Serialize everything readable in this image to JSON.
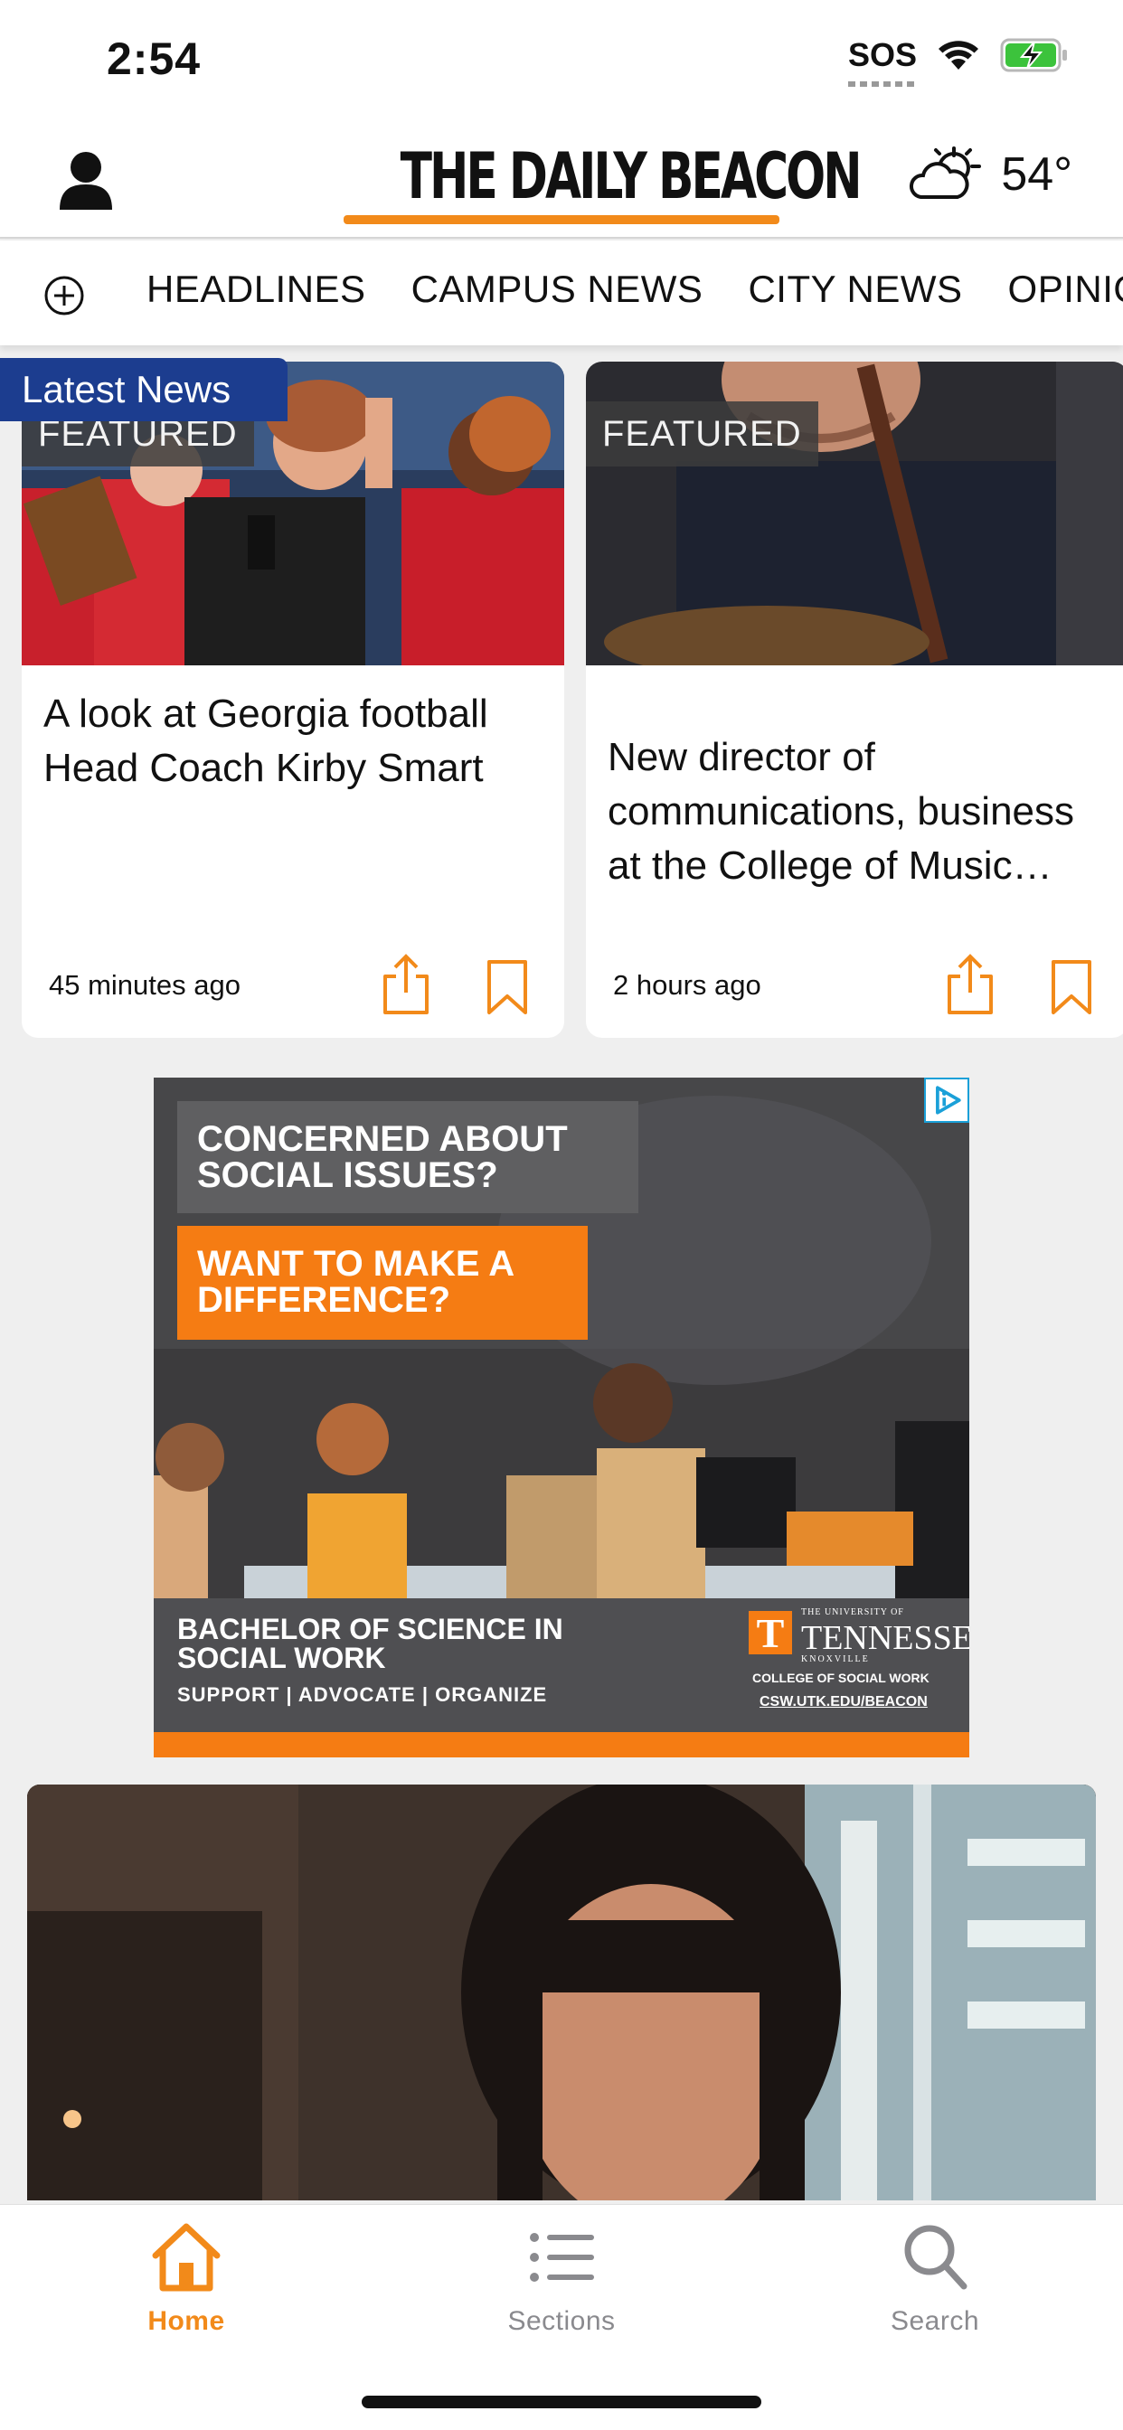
{
  "status_bar": {
    "time": "2:54",
    "sos": "SOS"
  },
  "header": {
    "masthead": "THE DAILY BEACON",
    "temperature": "54°",
    "accent_color": "#f28a1a"
  },
  "sections_nav": {
    "items": [
      "HEADLINES",
      "CAMPUS NEWS",
      "CITY NEWS",
      "OPINION"
    ]
  },
  "latest_label": "Latest News",
  "cards": [
    {
      "badge": "FEATURED",
      "title": "A look at Georgia football Head Coach Kirby Smart",
      "time": "45 minutes ago"
    },
    {
      "badge": "FEATURED",
      "title": "New director of communications, business at the College of Music…",
      "time": "2 hours ago"
    }
  ],
  "ad": {
    "headline_1": "CONCERNED ABOUT SOCIAL ISSUES?",
    "headline_2": "WANT TO MAKE A DIFFERENCE?",
    "program": "BACHELOR OF SCIENCE IN SOCIAL WORK",
    "tagline": "SUPPORT | ADVOCATE | ORGANIZE",
    "logo_letter": "T",
    "university_small": "THE UNIVERSITY OF",
    "university_name": "TENNESSEE",
    "university_city": "KNOXVILLE",
    "college": "COLLEGE OF SOCIAL WORK",
    "url": "CSW.UTK.EDU/BEACON"
  },
  "tab_bar": {
    "tabs": [
      {
        "label": "Home",
        "icon": "home-icon",
        "active": true
      },
      {
        "label": "Sections",
        "icon": "list-icon",
        "active": false
      },
      {
        "label": "Search",
        "icon": "search-icon",
        "active": false
      }
    ],
    "active_color": "#f28a1a",
    "inactive_color": "#8a8a8e"
  }
}
